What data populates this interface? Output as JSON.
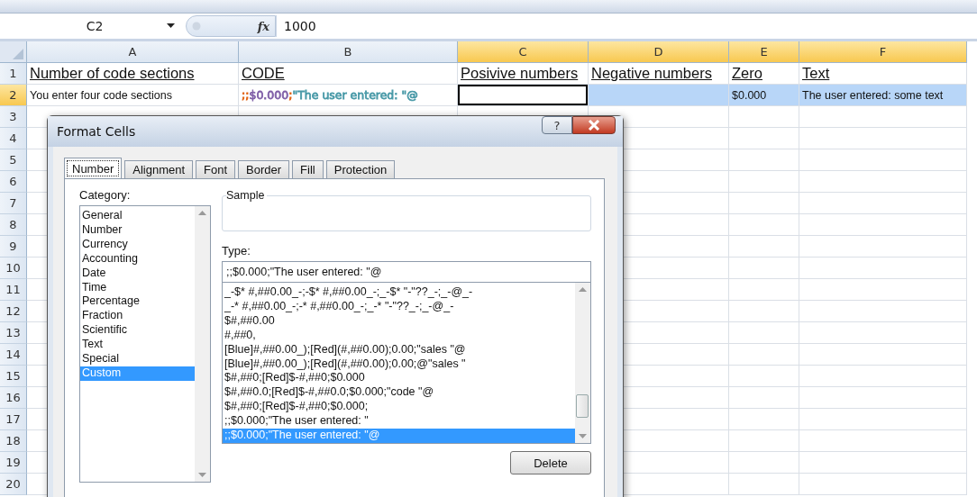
{
  "formula_bar": {
    "name_box": "C2",
    "function_label": "fx",
    "value": "1000"
  },
  "columns": [
    {
      "label": "A",
      "selected": false
    },
    {
      "label": "B",
      "selected": false
    },
    {
      "label": "C",
      "selected": true
    },
    {
      "label": "D",
      "selected": true
    },
    {
      "label": "E",
      "selected": true
    },
    {
      "label": "F",
      "selected": true
    }
  ],
  "rows": [
    {
      "label": "1",
      "selected": false,
      "cells": [
        {
          "text": "Number of code sections",
          "kind": "heading",
          "selected": false
        },
        {
          "text": "CODE",
          "kind": "heading",
          "selected": false
        },
        {
          "text": "Posivive numbers",
          "kind": "heading",
          "selected": false
        },
        {
          "text": "Negative numbers",
          "kind": "heading",
          "selected": false
        },
        {
          "text": "Zero",
          "kind": "heading",
          "selected": false
        },
        {
          "text": "Text",
          "kind": "heading",
          "selected": false
        }
      ]
    },
    {
      "label": "2",
      "selected": true,
      "cells": [
        {
          "text": "You enter four code sections",
          "kind": "plain",
          "selected": false
        },
        {
          "kind": "code",
          "selected": false,
          "segments": [
            {
              "text": ";;",
              "color": "#e06010"
            },
            {
              "text": "$0.000",
              "color": "#8060a8"
            },
            {
              "text": ";",
              "color": "#e06010"
            },
            {
              "text": "\"The user entered: \"@",
              "color": "#4a9aa8"
            }
          ]
        },
        {
          "text": "",
          "kind": "active",
          "selected": false
        },
        {
          "text": "",
          "kind": "plain",
          "selected": true
        },
        {
          "text": "$0.000",
          "kind": "plain",
          "selected": true
        },
        {
          "text": "The user entered: some text",
          "kind": "plain",
          "selected": true
        }
      ]
    },
    {
      "label": "3",
      "selected": false
    },
    {
      "label": "4",
      "selected": false
    },
    {
      "label": "5",
      "selected": false
    },
    {
      "label": "6",
      "selected": false
    },
    {
      "label": "7",
      "selected": false
    },
    {
      "label": "8",
      "selected": false
    },
    {
      "label": "9",
      "selected": false
    },
    {
      "label": "10",
      "selected": false
    },
    {
      "label": "11",
      "selected": false
    },
    {
      "label": "12",
      "selected": false
    },
    {
      "label": "13",
      "selected": false
    },
    {
      "label": "14",
      "selected": false
    },
    {
      "label": "15",
      "selected": false
    },
    {
      "label": "16",
      "selected": false
    },
    {
      "label": "17",
      "selected": false
    },
    {
      "label": "18",
      "selected": false
    },
    {
      "label": "19",
      "selected": false
    },
    {
      "label": "20",
      "selected": false
    }
  ],
  "dialog": {
    "title": "Format Cells",
    "help": "?",
    "tabs": [
      {
        "label": "Number",
        "selected": true
      },
      {
        "label": "Alignment",
        "selected": false
      },
      {
        "label": "Font",
        "selected": false
      },
      {
        "label": "Border",
        "selected": false
      },
      {
        "label": "Fill",
        "selected": false
      },
      {
        "label": "Protection",
        "selected": false
      }
    ],
    "category_label": "Category:",
    "categories": [
      {
        "label": "General",
        "selected": false
      },
      {
        "label": "Number",
        "selected": false
      },
      {
        "label": "Currency",
        "selected": false
      },
      {
        "label": "Accounting",
        "selected": false
      },
      {
        "label": "Date",
        "selected": false
      },
      {
        "label": "Time",
        "selected": false
      },
      {
        "label": "Percentage",
        "selected": false
      },
      {
        "label": "Fraction",
        "selected": false
      },
      {
        "label": "Scientific",
        "selected": false
      },
      {
        "label": "Text",
        "selected": false
      },
      {
        "label": "Special",
        "selected": false
      },
      {
        "label": "Custom",
        "selected": true
      }
    ],
    "sample_label": "Sample",
    "type_label": "Type:",
    "type_value": ";;$0.000;\"The user entered: \"@",
    "formats": [
      {
        "label": "_-$* #,##0.00_-;-$* #,##0.00_-;_-$* \"-\"??_-;_-@_-",
        "selected": false
      },
      {
        "label": "_-* #,##0.00_-;-* #,##0.00_-;_-* \"-\"??_-;_-@_-",
        "selected": false
      },
      {
        "label": "$#,##0.00",
        "selected": false
      },
      {
        "label": "#,##0,",
        "selected": false
      },
      {
        "label": "[Blue]#,##0.00_);[Red](#,##0.00);0.00;\"sales \"@",
        "selected": false
      },
      {
        "label": "[Blue]#,##0.00_);[Red](#,##0.00);0.00;@\"sales \"",
        "selected": false
      },
      {
        "label": "$#,##0;[Red]$-#,##0;$0.000",
        "selected": false
      },
      {
        "label": "$#,##0.0;[Red]$-#,##0.0;$0.000;\"code \"@",
        "selected": false
      },
      {
        "label": "$#,##0;[Red]$-#,##0;$0.000;",
        "selected": false
      },
      {
        "label": ";;$0.000;\"The user entered: \"",
        "selected": false
      },
      {
        "label": ";;$0.000;\"The user entered: \"@",
        "selected": true
      }
    ],
    "delete_button": "Delete"
  }
}
